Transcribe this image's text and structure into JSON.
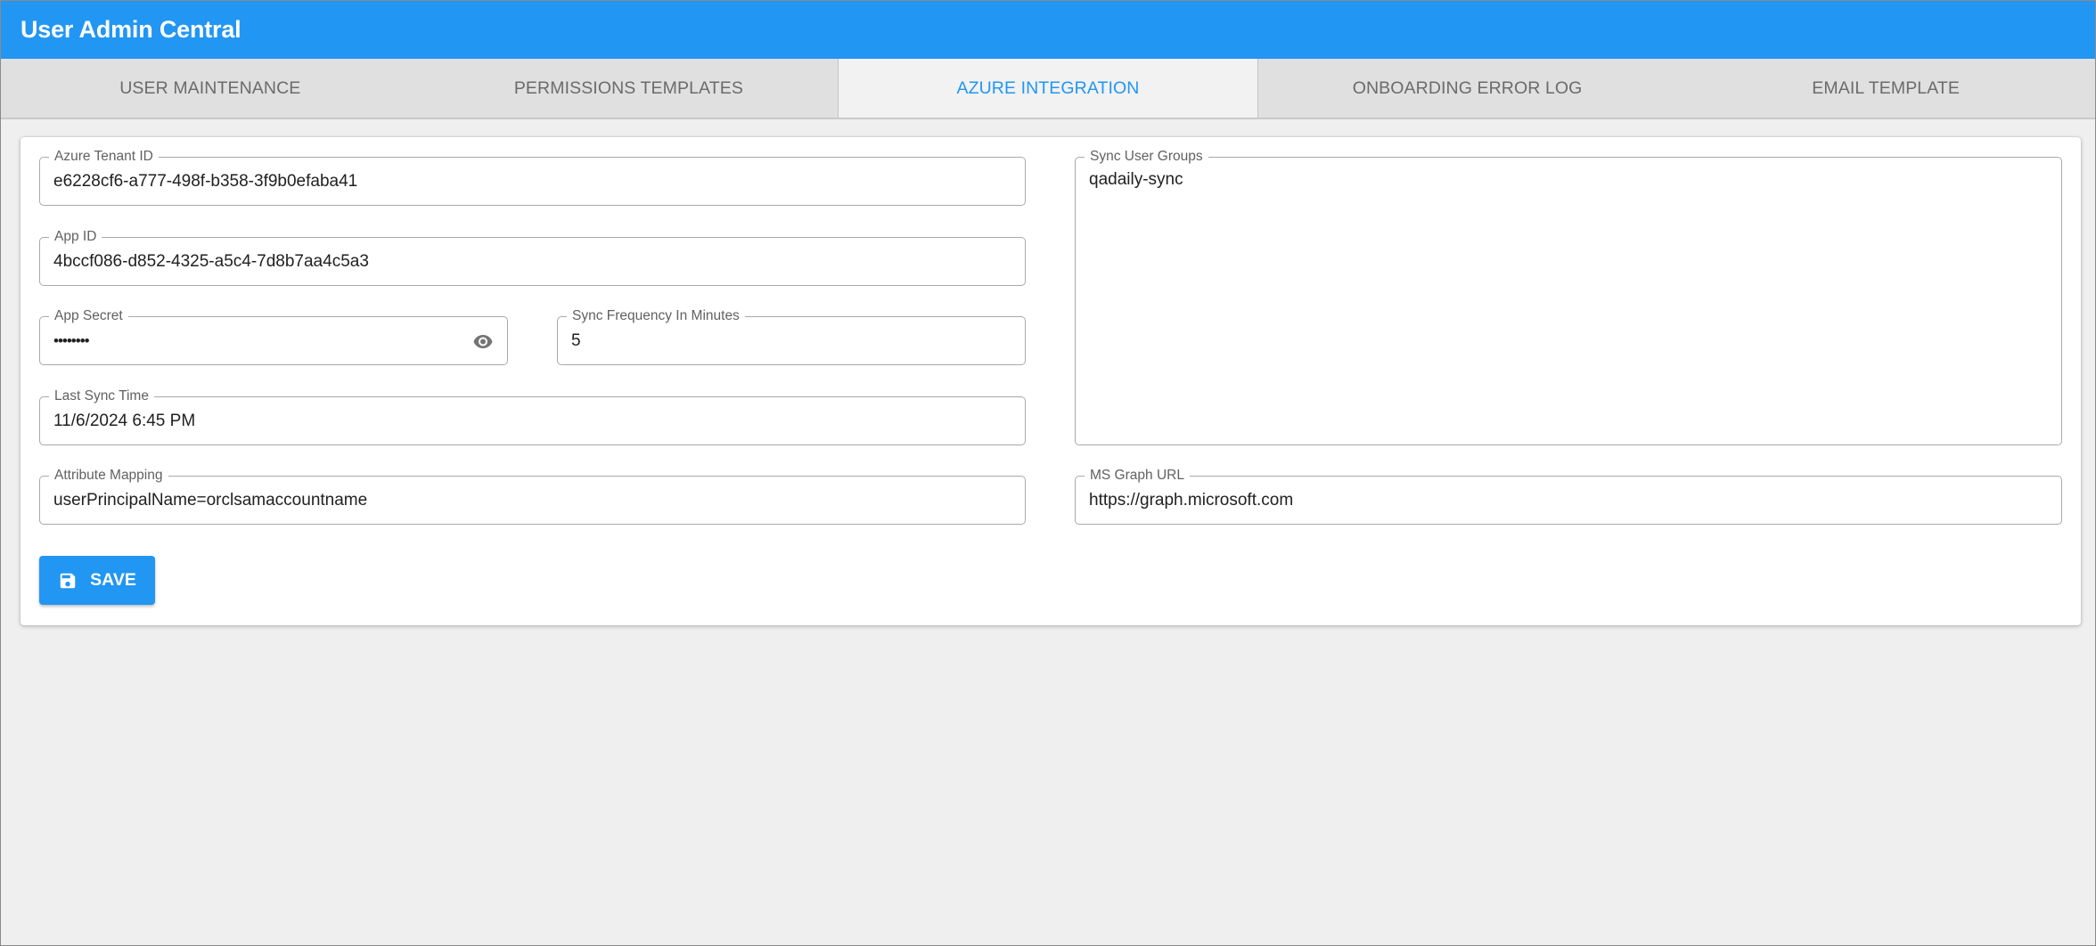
{
  "app": {
    "title": "User Admin Central",
    "accent_color": "#2196f3"
  },
  "tabs": [
    {
      "label": "USER MAINTENANCE",
      "active": false
    },
    {
      "label": "PERMISSIONS TEMPLATES",
      "active": false
    },
    {
      "label": "AZURE INTEGRATION",
      "active": true
    },
    {
      "label": "ONBOARDING ERROR LOG",
      "active": false
    },
    {
      "label": "EMAIL TEMPLATE",
      "active": false
    }
  ],
  "form": {
    "azure_tenant_id": {
      "label": "Azure Tenant ID",
      "value": "e6228cf6-a777-498f-b358-3f9b0efaba41"
    },
    "app_id": {
      "label": "App ID",
      "value": "4bccf086-d852-4325-a5c4-7d8b7aa4c5a3"
    },
    "app_secret": {
      "label": "App Secret",
      "value": "••••••••",
      "toggle_icon": "eye-icon"
    },
    "sync_frequency": {
      "label": "Sync Frequency In Minutes",
      "value": "5"
    },
    "last_sync_time": {
      "label": "Last Sync Time",
      "value": "11/6/2024 6:45 PM"
    },
    "attribute_mapping": {
      "label": "Attribute Mapping",
      "value": "userPrincipalName=orclsamaccountname"
    },
    "sync_user_groups": {
      "label": "Sync User Groups",
      "value": "qadaily-sync"
    },
    "ms_graph_url": {
      "label": "MS Graph URL",
      "value": "https://graph.microsoft.com"
    }
  },
  "save_button": {
    "label": "SAVE",
    "icon": "save-icon"
  }
}
